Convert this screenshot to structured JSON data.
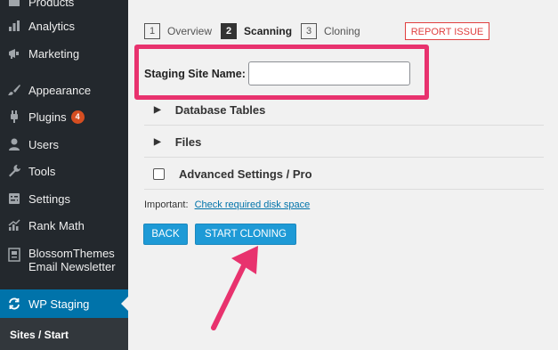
{
  "sidebar": {
    "items": [
      {
        "label": "Products",
        "icon": "products-icon"
      },
      {
        "label": "Analytics",
        "icon": "analytics-icon"
      },
      {
        "label": "Marketing",
        "icon": "megaphone-icon"
      },
      {
        "label": "Appearance",
        "icon": "brush-icon"
      },
      {
        "label": "Plugins",
        "icon": "plugin-icon",
        "badge": "4"
      },
      {
        "label": "Users",
        "icon": "user-icon"
      },
      {
        "label": "Tools",
        "icon": "wrench-icon"
      },
      {
        "label": "Settings",
        "icon": "settings-icon"
      },
      {
        "label": "Rank Math",
        "icon": "chart-icon"
      },
      {
        "label": "BlossomThemes Email Newsletter",
        "line1": "BlossomThemes",
        "line2": "Email Newsletter",
        "icon": "newsletter-icon"
      },
      {
        "label": "WP Staging",
        "icon": "sync-icon",
        "active": true
      }
    ],
    "submenu": {
      "label": "Sites / Start"
    }
  },
  "steps": [
    {
      "num": "1",
      "label": "Overview",
      "current": false
    },
    {
      "num": "2",
      "label": "Scanning",
      "current": true
    },
    {
      "num": "3",
      "label": "Cloning",
      "current": false
    }
  ],
  "report_button": "REPORT ISSUE",
  "staging": {
    "label": "Staging Site Name:",
    "value": "",
    "placeholder": ""
  },
  "sections": {
    "database_tables": "Database Tables",
    "files": "Files",
    "advanced": "Advanced Settings / Pro"
  },
  "important": {
    "prefix": "Important:",
    "link": "Check required disk space"
  },
  "buttons": {
    "back": "BACK",
    "start": "START CLONING"
  },
  "colors": {
    "sidebar_bg": "#23282d",
    "active_bg": "#0073aa",
    "button_blue": "#1e9ad6",
    "highlight": "#e8326e",
    "report_red": "#e04040"
  }
}
